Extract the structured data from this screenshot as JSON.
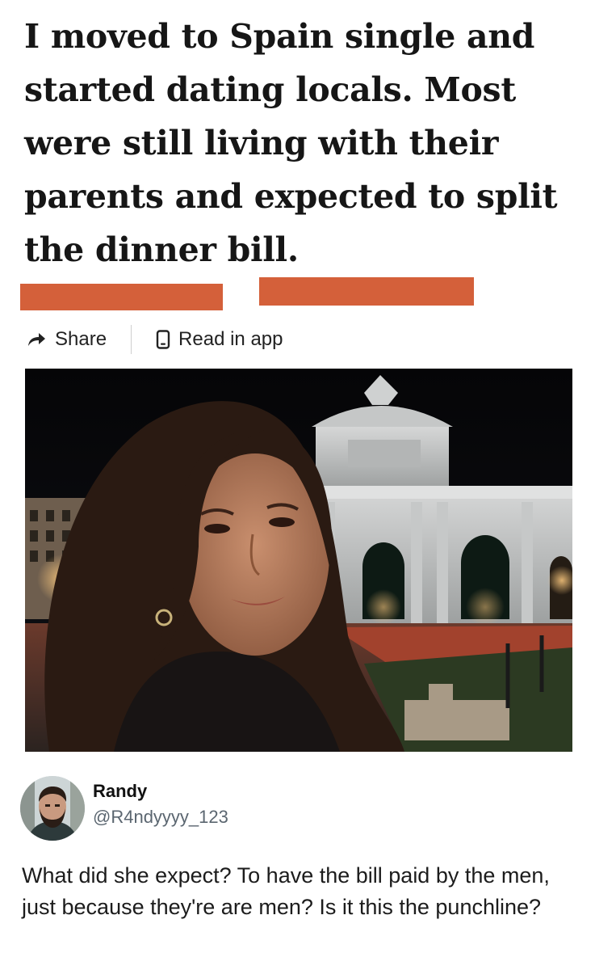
{
  "article": {
    "headline": "I moved to Spain single and started dating locals. Most were still living with their parents and expected to split the dinner bill."
  },
  "actions": {
    "share_label": "Share",
    "read_in_app_label": "Read in app",
    "share_icon": "share-arrow-icon",
    "app_icon": "phone-icon"
  },
  "photo": {
    "description_icon": "photo"
  },
  "tweet": {
    "name": "Randy",
    "handle": "@R4ndyyyy_123",
    "text": "What did she expect? To have the bill paid by the men, just because they're are men? Is it this the punchline?"
  },
  "colors": {
    "redaction": "#d4603a",
    "handle": "#5b6670"
  }
}
